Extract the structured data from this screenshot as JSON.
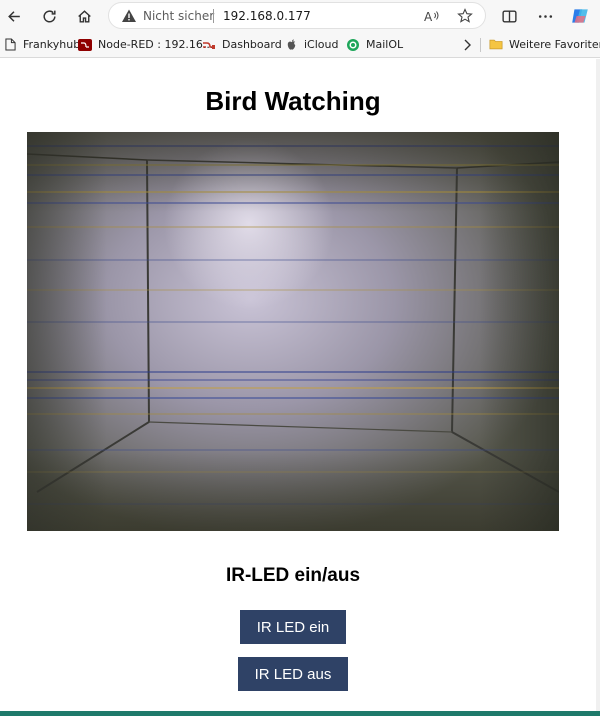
{
  "browser": {
    "security_label": "Nicht sicher",
    "url": "192.168.0.177",
    "icons": {
      "back": "arrow-left-icon",
      "reload": "reload-icon",
      "home": "home-icon",
      "warning": "warning-icon",
      "read_aloud": "read-aloud-icon",
      "favorite": "star-icon",
      "split_screen": "split-screen-icon",
      "more": "more-icon",
      "copilot": "copilot-icon"
    },
    "bookmarks": [
      {
        "label": "Frankyhub",
        "icon": "page-icon"
      },
      {
        "label": "Node-RED : 192.16...",
        "icon": "node-red-icon"
      },
      {
        "label": "Dashboard",
        "icon": "dashboard-icon"
      },
      {
        "label": "iCloud",
        "icon": "apple-icon"
      },
      {
        "label": "MailOL",
        "icon": "mail-icon"
      }
    ],
    "more_favorites": "Weitere Favoriten"
  },
  "page": {
    "title": "Bird Watching",
    "ir_heading": "IR-LED ein/aus",
    "btn_on": "IR LED ein",
    "btn_off": "IR LED aus"
  },
  "colors": {
    "button": "#2f4266",
    "accent_bar": "#1f7a6b"
  }
}
